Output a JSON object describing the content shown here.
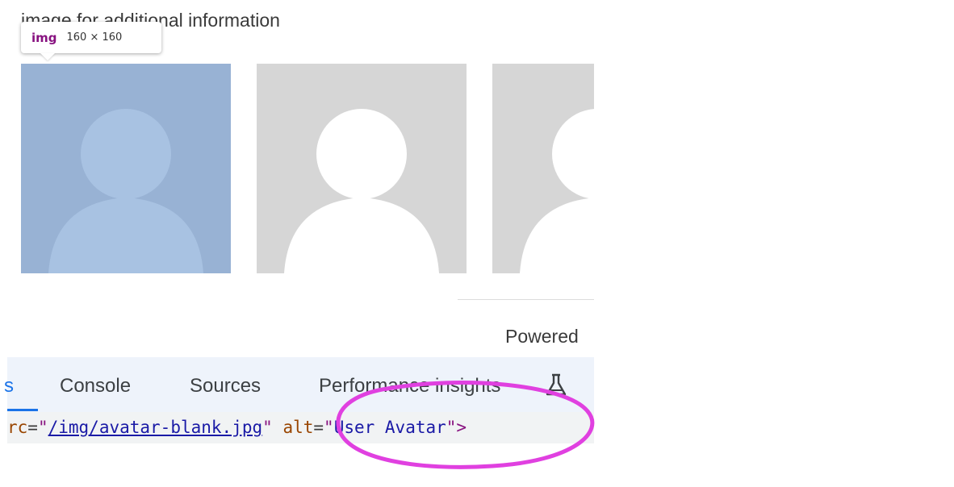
{
  "page": {
    "instruction_text": "image for additional information",
    "powered_text": "Powered"
  },
  "tooltip": {
    "tag": "img",
    "dimensions": "160 × 160"
  },
  "avatars": [
    {
      "name": "selected",
      "bg": "#98b2d4",
      "fg": "#a8c2e2"
    },
    {
      "name": "avatar-2",
      "bg": "#d6d6d6",
      "fg": "#ffffff"
    },
    {
      "name": "avatar-3",
      "bg": "#d6d6d6",
      "fg": "#ffffff"
    }
  ],
  "devtools": {
    "tabs": {
      "elements": "s",
      "console": "Console",
      "sources": "Sources",
      "performance_insights": "Performance insights"
    },
    "code": {
      "src_attr_fragment": "rc",
      "src_value": "/img/avatar-blank.jpg",
      "alt_attr": "alt",
      "alt_value": "User Avatar"
    }
  },
  "colors": {
    "accent": "#1a73e8",
    "annotation": "#e040e0"
  }
}
